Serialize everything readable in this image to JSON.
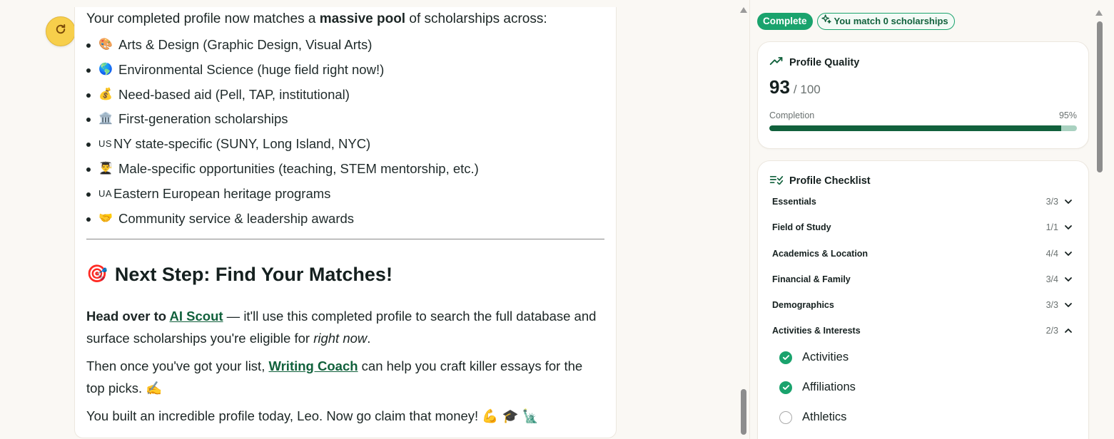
{
  "chat": {
    "intro_prefix": "Your completed profile now matches a ",
    "intro_bold": "massive pool",
    "intro_suffix": " of scholarships across:",
    "pool_items": [
      {
        "emoji": "🎨",
        "text": "Arts & Design (Graphic Design, Visual Arts)"
      },
      {
        "emoji": "🌎",
        "text": "Environmental Science (huge field right now!)"
      },
      {
        "emoji": "💰",
        "text": "Need-based aid (Pell, TAP, institutional)"
      },
      {
        "emoji": "🏛️",
        "text": "First-generation scholarships"
      },
      {
        "emoji": "US",
        "text": "NY state-specific (SUNY, Long Island, NYC)"
      },
      {
        "emoji": "👨‍🎓",
        "text": "Male-specific opportunities (teaching, STEM mentorship, etc.)"
      },
      {
        "emoji": "UA",
        "text": "Eastern European heritage programs"
      },
      {
        "emoji": "🤝",
        "text": "Community service & leadership awards"
      }
    ],
    "next_heading_emoji": "🎯",
    "next_heading": "Next Step: Find Your Matches!",
    "p1_bold": "Head over to ",
    "p1_link": "AI Scout",
    "p1_rest": " — it'll use this completed profile to search the full database and surface scholarships you're eligible for ",
    "p1_italic": "right now",
    "p1_end": ".",
    "p2_start": "Then once you've got your list, ",
    "p2_link": "Writing Coach",
    "p2_rest": " can help you craft killer essays for the top picks. ✍️",
    "p3": "You built an incredible profile today, Leo. Now go claim that money! 💪 🎓 🗽"
  },
  "sidebar": {
    "status_badge": "Complete",
    "match_badge": "You match 0 scholarships",
    "quality": {
      "title": "Profile Quality",
      "score": "93",
      "score_total": "/ 100",
      "completion_label": "Completion",
      "completion_pct": "95%",
      "completion_value": 0.95
    },
    "checklist": {
      "title": "Profile Checklist",
      "categories": [
        {
          "name": "Essentials",
          "count": "3/3",
          "expanded": false
        },
        {
          "name": "Field of Study",
          "count": "1/1",
          "expanded": false
        },
        {
          "name": "Academics & Location",
          "count": "4/4",
          "expanded": false
        },
        {
          "name": "Financial & Family",
          "count": "3/4",
          "expanded": false
        },
        {
          "name": "Demographics",
          "count": "3/3",
          "expanded": false
        },
        {
          "name": "Activities & Interests",
          "count": "2/3",
          "expanded": true
        }
      ],
      "sub_items": [
        {
          "label": "Activities",
          "done": true
        },
        {
          "label": "Affiliations",
          "done": true
        },
        {
          "label": "Athletics",
          "done": false
        }
      ]
    }
  },
  "colors": {
    "accent": "#1aa36d",
    "accent_dark": "#11613c",
    "refresh": "#f7cf4b"
  },
  "icons": [
    "refresh-icon",
    "sparkle-icon",
    "trend-up-icon",
    "checklist-icon",
    "chevron-down-icon",
    "chevron-up-icon",
    "check-circle-icon",
    "empty-circle-icon"
  ]
}
